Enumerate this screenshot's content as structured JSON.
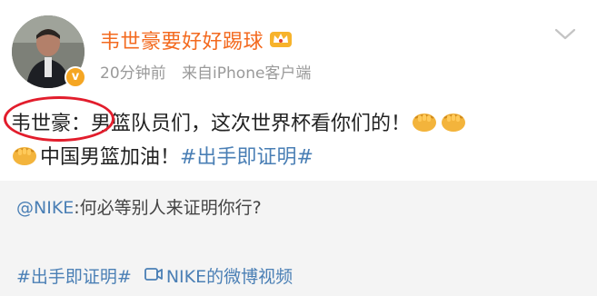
{
  "post": {
    "username": "韦世豪要好好踢球",
    "time": "20分钟前",
    "source": "来自iPhone客户端",
    "line1_name": "韦世豪：",
    "line1_text": "男篮队员们，这次世界杯看你们的！",
    "line2_text": "中国男篮加油！",
    "hashtag": "#出手即证明#"
  },
  "repost": {
    "mention": "@NIKE",
    "text": ":何必等别人来证明你行?",
    "hashtag": "#出手即证明#",
    "video_label": "NIKE的微博视频"
  },
  "colors": {
    "username": "#f36a1f",
    "link": "#4a7fb5",
    "highlight_circle": "#e21d2c",
    "repost_bg": "#f4f4f4"
  },
  "icons": [
    "verified-icon",
    "crown-icon",
    "chevron-down-icon",
    "fist-emoji-icon",
    "video-icon"
  ]
}
